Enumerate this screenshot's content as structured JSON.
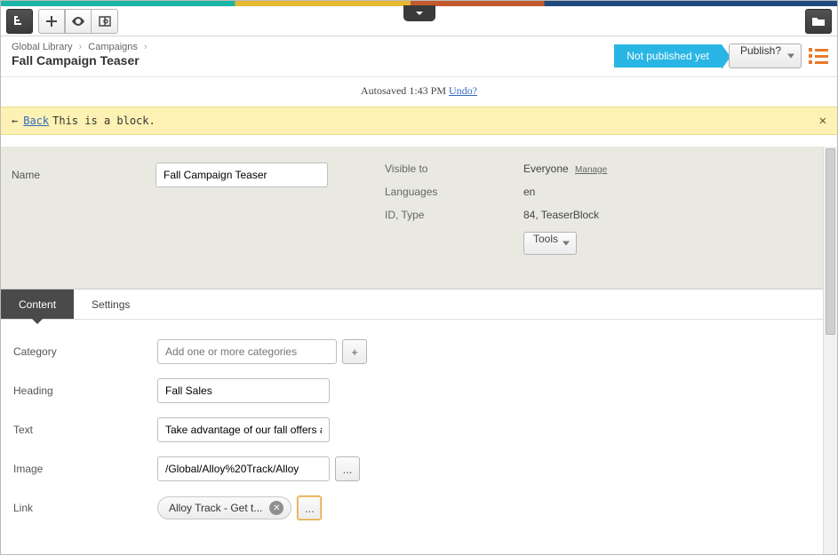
{
  "toolbar": {
    "tree_icon": "tree-icon",
    "add_icon": "plus",
    "preview_icon": "eye",
    "compare_icon": "compare",
    "folder_icon": "folder"
  },
  "breadcrumb": {
    "root": "Global Library",
    "child": "Campaigns"
  },
  "page_title": "Fall Campaign Teaser",
  "status_label": "Not published yet",
  "publish_label": "Publish?",
  "autosave": {
    "prefix": "Autosaved",
    "time": "1:43 PM",
    "undo": "Undo?"
  },
  "notice": {
    "back": "Back",
    "text": "This is a block."
  },
  "meta": {
    "name_label": "Name",
    "name_value": "Fall Campaign Teaser",
    "visible_label": "Visible to",
    "visible_value": "Everyone",
    "manage": "Manage",
    "languages_label": "Languages",
    "languages_value": "en",
    "idtype_label": "ID, Type",
    "idtype_value": "84, TeaserBlock",
    "tools": "Tools"
  },
  "tabs": {
    "content": "Content",
    "settings": "Settings"
  },
  "form": {
    "category_label": "Category",
    "category_placeholder": "Add one or more categories",
    "heading_label": "Heading",
    "heading_value": "Fall Sales",
    "text_label": "Text",
    "text_value": "Take advantage of our fall offers and discounts",
    "image_label": "Image",
    "image_value": "/Global/Alloy%20Track/Alloy",
    "link_label": "Link",
    "link_pill": "Alloy Track - Get t...",
    "ellipsis": "...",
    "plus": "+"
  }
}
